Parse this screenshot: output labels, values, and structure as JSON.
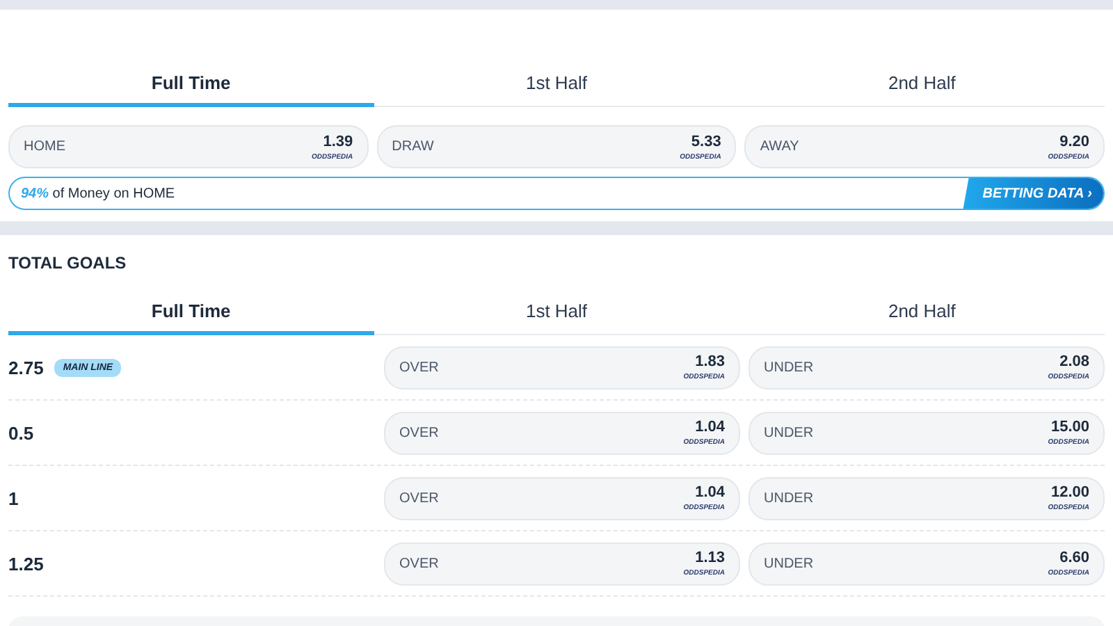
{
  "match_odds": {
    "tabs": [
      {
        "label": "Full Time",
        "selected": true
      },
      {
        "label": "1st Half",
        "selected": false
      },
      {
        "label": "2nd Half",
        "selected": false
      }
    ],
    "odds": [
      {
        "label": "HOME",
        "price": "1.39",
        "provider": "ODDSPEDIA"
      },
      {
        "label": "DRAW",
        "price": "5.33",
        "provider": "ODDSPEDIA"
      },
      {
        "label": "AWAY",
        "price": "9.20",
        "provider": "ODDSPEDIA"
      }
    ],
    "money_bar": {
      "percent": "94%",
      "text": "of Money on HOME",
      "button": "BETTING DATA ›"
    }
  },
  "total_goals": {
    "title": "TOTAL GOALS",
    "tabs": [
      {
        "label": "Full Time",
        "selected": true
      },
      {
        "label": "1st Half",
        "selected": false
      },
      {
        "label": "2nd Half",
        "selected": false
      }
    ],
    "rows": [
      {
        "line": "2.75",
        "badge": "MAIN LINE",
        "over": {
          "label": "OVER",
          "price": "1.83",
          "provider": "ODDSPEDIA"
        },
        "under": {
          "label": "UNDER",
          "price": "2.08",
          "provider": "ODDSPEDIA"
        }
      },
      {
        "line": "0.5",
        "over": {
          "label": "OVER",
          "price": "1.04",
          "provider": "ODDSPEDIA"
        },
        "under": {
          "label": "UNDER",
          "price": "15.00",
          "provider": "ODDSPEDIA"
        }
      },
      {
        "line": "1",
        "over": {
          "label": "OVER",
          "price": "1.04",
          "provider": "ODDSPEDIA"
        },
        "under": {
          "label": "UNDER",
          "price": "12.00",
          "provider": "ODDSPEDIA"
        }
      },
      {
        "line": "1.25",
        "over": {
          "label": "OVER",
          "price": "1.13",
          "provider": "ODDSPEDIA"
        },
        "under": {
          "label": "UNDER",
          "price": "6.60",
          "provider": "ODDSPEDIA"
        }
      }
    ]
  }
}
